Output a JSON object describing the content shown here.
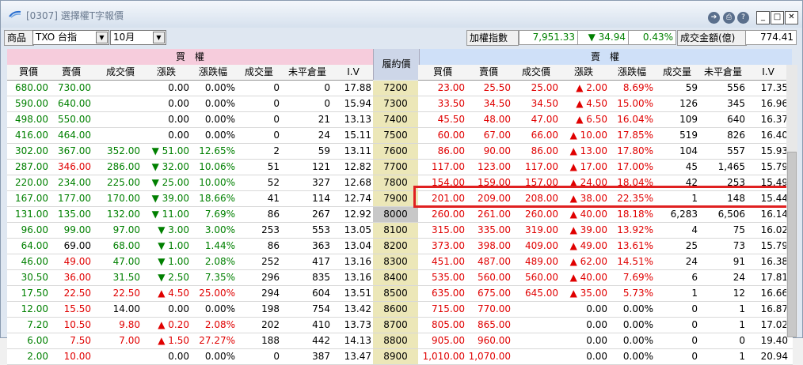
{
  "window": {
    "title": "[0307] 選擇權T字報價",
    "buttons": {
      "export": "➔",
      "print": "⎙",
      "help": "?",
      "minimize": "_",
      "maximize": "□",
      "close": "✕"
    }
  },
  "toolbar": {
    "product_label": "商品",
    "product_value": "TXO 台指",
    "month_value": "10月",
    "index_label": "加權指數",
    "index_value": "7,951.33",
    "index_change": "▼ 34.94",
    "index_pct": "0.43%",
    "turnover_label": "成交金額(億)",
    "turnover_value": "774.41"
  },
  "headers": {
    "buy_group": "買　權",
    "sell_group": "賣　權",
    "strike": "履約價",
    "call_cols": [
      "買價",
      "賣價",
      "成交價",
      "漲跌",
      "漲跌幅",
      "成交量",
      "未平倉量",
      "I.V"
    ],
    "put_cols": [
      "買價",
      "賣價",
      "成交價",
      "漲跌",
      "漲跌幅",
      "成交量",
      "未平倉量",
      "I.V"
    ]
  },
  "colors": {
    "up": "#e00000",
    "down": "#008000",
    "highlight": "#e02020"
  },
  "rows": [
    {
      "c": [
        "680.00",
        "730.00",
        "",
        "0.00",
        "0.00%",
        "0",
        "0",
        "17.88"
      ],
      "k": "7200",
      "p": [
        "23.00",
        "25.50",
        "25.00",
        "▲ 2.00",
        "8.69%",
        "59",
        "556",
        "17.35"
      ],
      "cc": [
        "down",
        "down",
        "neu",
        "neu",
        "neu",
        "neu",
        "neu",
        "neu"
      ],
      "pc": [
        "up",
        "up",
        "up",
        "up",
        "up",
        "neu",
        "neu",
        "neu"
      ]
    },
    {
      "c": [
        "590.00",
        "640.00",
        "",
        "0.00",
        "0.00%",
        "0",
        "0",
        "15.94"
      ],
      "k": "7300",
      "p": [
        "33.50",
        "34.50",
        "34.50",
        "▲ 4.50",
        "15.00%",
        "126",
        "345",
        "16.96"
      ],
      "cc": [
        "down",
        "down",
        "neu",
        "neu",
        "neu",
        "neu",
        "neu",
        "neu"
      ],
      "pc": [
        "up",
        "up",
        "up",
        "up",
        "up",
        "neu",
        "neu",
        "neu"
      ]
    },
    {
      "c": [
        "498.00",
        "550.00",
        "",
        "0.00",
        "0.00%",
        "0",
        "21",
        "13.13"
      ],
      "k": "7400",
      "p": [
        "45.50",
        "48.00",
        "47.00",
        "▲ 6.50",
        "16.04%",
        "109",
        "640",
        "16.37"
      ],
      "cc": [
        "down",
        "down",
        "neu",
        "neu",
        "neu",
        "neu",
        "neu",
        "neu"
      ],
      "pc": [
        "up",
        "up",
        "up",
        "up",
        "up",
        "neu",
        "neu",
        "neu"
      ]
    },
    {
      "c": [
        "416.00",
        "464.00",
        "",
        "0.00",
        "0.00%",
        "0",
        "24",
        "15.11"
      ],
      "k": "7500",
      "p": [
        "60.00",
        "67.00",
        "66.00",
        "▲ 10.00",
        "17.85%",
        "519",
        "826",
        "16.40"
      ],
      "cc": [
        "down",
        "down",
        "neu",
        "neu",
        "neu",
        "neu",
        "neu",
        "neu"
      ],
      "pc": [
        "up",
        "up",
        "up",
        "up",
        "up",
        "neu",
        "neu",
        "neu"
      ]
    },
    {
      "c": [
        "302.00",
        "367.00",
        "352.00",
        "▼ 51.00",
        "12.65%",
        "2",
        "59",
        "13.11"
      ],
      "k": "7600",
      "p": [
        "86.00",
        "90.00",
        "86.00",
        "▲ 13.00",
        "17.80%",
        "104",
        "557",
        "15.93"
      ],
      "cc": [
        "down",
        "down",
        "down",
        "down",
        "down",
        "neu",
        "neu",
        "neu"
      ],
      "pc": [
        "up",
        "up",
        "up",
        "up",
        "up",
        "neu",
        "neu",
        "neu"
      ]
    },
    {
      "c": [
        "287.00",
        "346.00",
        "286.00",
        "▼ 32.00",
        "10.06%",
        "51",
        "121",
        "12.82"
      ],
      "k": "7700",
      "p": [
        "117.00",
        "123.00",
        "117.00",
        "▲ 17.00",
        "17.00%",
        "45",
        "1,465",
        "15.79"
      ],
      "cc": [
        "down",
        "up",
        "down",
        "down",
        "down",
        "neu",
        "neu",
        "neu"
      ],
      "pc": [
        "up",
        "up",
        "up",
        "up",
        "up",
        "neu",
        "neu",
        "neu"
      ]
    },
    {
      "c": [
        "220.00",
        "234.00",
        "225.00",
        "▼ 25.00",
        "10.00%",
        "52",
        "327",
        "12.68"
      ],
      "k": "7800",
      "p": [
        "154.00",
        "159.00",
        "157.00",
        "▲ 24.00",
        "18.04%",
        "42",
        "253",
        "15.49"
      ],
      "cc": [
        "down",
        "down",
        "down",
        "down",
        "down",
        "neu",
        "neu",
        "neu"
      ],
      "pc": [
        "up",
        "up",
        "up",
        "up",
        "up",
        "neu",
        "neu",
        "neu"
      ]
    },
    {
      "c": [
        "167.00",
        "177.00",
        "170.00",
        "▼ 39.00",
        "18.66%",
        "41",
        "114",
        "12.74"
      ],
      "k": "7900",
      "p": [
        "201.00",
        "209.00",
        "208.00",
        "▲ 38.00",
        "22.35%",
        "1",
        "148",
        "15.44"
      ],
      "cc": [
        "down",
        "down",
        "down",
        "down",
        "down",
        "neu",
        "neu",
        "neu"
      ],
      "pc": [
        "up",
        "up",
        "up",
        "up",
        "up",
        "neu",
        "neu",
        "neu"
      ]
    },
    {
      "c": [
        "131.00",
        "135.00",
        "132.00",
        "▼ 11.00",
        "7.69%",
        "86",
        "267",
        "12.92"
      ],
      "k": "8000",
      "p": [
        "260.00",
        "261.00",
        "260.00",
        "▲ 40.00",
        "18.18%",
        "6,283",
        "6,506",
        "16.14"
      ],
      "cc": [
        "down",
        "down",
        "down",
        "down",
        "down",
        "neu",
        "neu",
        "neu"
      ],
      "pc": [
        "up",
        "up",
        "up",
        "up",
        "up",
        "neu",
        "neu",
        "neu"
      ],
      "atm": true
    },
    {
      "c": [
        "96.00",
        "99.00",
        "97.00",
        "▼ 3.00",
        "3.00%",
        "253",
        "553",
        "13.05"
      ],
      "k": "8100",
      "p": [
        "315.00",
        "335.00",
        "319.00",
        "▲ 39.00",
        "13.92%",
        "4",
        "75",
        "16.02"
      ],
      "cc": [
        "down",
        "down",
        "down",
        "down",
        "down",
        "neu",
        "neu",
        "neu"
      ],
      "pc": [
        "up",
        "up",
        "up",
        "up",
        "up",
        "neu",
        "neu",
        "neu"
      ]
    },
    {
      "c": [
        "64.00",
        "69.00",
        "68.00",
        "▼ 1.00",
        "1.44%",
        "86",
        "363",
        "13.04"
      ],
      "k": "8200",
      "p": [
        "373.00",
        "398.00",
        "409.00",
        "▲ 49.00",
        "13.61%",
        "25",
        "73",
        "15.79"
      ],
      "cc": [
        "down",
        "neu",
        "down",
        "down",
        "down",
        "neu",
        "neu",
        "neu"
      ],
      "pc": [
        "up",
        "up",
        "up",
        "up",
        "up",
        "neu",
        "neu",
        "neu"
      ]
    },
    {
      "c": [
        "46.00",
        "49.00",
        "47.00",
        "▼ 1.00",
        "2.08%",
        "252",
        "417",
        "13.16"
      ],
      "k": "8300",
      "p": [
        "451.00",
        "487.00",
        "489.00",
        "▲ 62.00",
        "14.51%",
        "24",
        "91",
        "16.38"
      ],
      "cc": [
        "down",
        "up",
        "down",
        "down",
        "down",
        "neu",
        "neu",
        "neu"
      ],
      "pc": [
        "up",
        "up",
        "up",
        "up",
        "up",
        "neu",
        "neu",
        "neu"
      ]
    },
    {
      "c": [
        "30.50",
        "36.00",
        "31.50",
        "▼ 2.50",
        "7.35%",
        "296",
        "835",
        "13.16"
      ],
      "k": "8400",
      "p": [
        "535.00",
        "560.00",
        "560.00",
        "▲ 40.00",
        "7.69%",
        "6",
        "24",
        "17.81"
      ],
      "cc": [
        "down",
        "up",
        "down",
        "down",
        "down",
        "neu",
        "neu",
        "neu"
      ],
      "pc": [
        "up",
        "up",
        "up",
        "up",
        "up",
        "neu",
        "neu",
        "neu"
      ]
    },
    {
      "c": [
        "17.50",
        "22.50",
        "22.50",
        "▲ 4.50",
        "25.00%",
        "294",
        "604",
        "13.51"
      ],
      "k": "8500",
      "p": [
        "635.00",
        "675.00",
        "645.00",
        "▲ 35.00",
        "5.73%",
        "1",
        "12",
        "16.66"
      ],
      "cc": [
        "down",
        "up",
        "up",
        "up",
        "up",
        "neu",
        "neu",
        "neu"
      ],
      "pc": [
        "up",
        "up",
        "up",
        "up",
        "up",
        "neu",
        "neu",
        "neu"
      ]
    },
    {
      "c": [
        "12.00",
        "15.50",
        "14.00",
        "0.00",
        "0.00%",
        "198",
        "754",
        "13.42"
      ],
      "k": "8600",
      "p": [
        "715.00",
        "770.00",
        "",
        "0.00",
        "0.00%",
        "0",
        "1",
        "16.87"
      ],
      "cc": [
        "down",
        "up",
        "neu",
        "neu",
        "neu",
        "neu",
        "neu",
        "neu"
      ],
      "pc": [
        "up",
        "up",
        "neu",
        "neu",
        "neu",
        "neu",
        "neu",
        "neu"
      ]
    },
    {
      "c": [
        "7.20",
        "10.50",
        "9.80",
        "▲ 0.20",
        "2.08%",
        "202",
        "410",
        "13.73"
      ],
      "k": "8700",
      "p": [
        "805.00",
        "865.00",
        "",
        "0.00",
        "0.00%",
        "0",
        "1",
        "17.02"
      ],
      "cc": [
        "down",
        "up",
        "up",
        "up",
        "up",
        "neu",
        "neu",
        "neu"
      ],
      "pc": [
        "up",
        "up",
        "neu",
        "neu",
        "neu",
        "neu",
        "neu",
        "neu"
      ]
    },
    {
      "c": [
        "6.00",
        "7.50",
        "7.00",
        "▲ 1.50",
        "27.27%",
        "188",
        "442",
        "14.13"
      ],
      "k": "8800",
      "p": [
        "905.00",
        "960.00",
        "",
        "0.00",
        "0.00%",
        "0",
        "0",
        "19.40"
      ],
      "cc": [
        "down",
        "up",
        "up",
        "up",
        "up",
        "neu",
        "neu",
        "neu"
      ],
      "pc": [
        "up",
        "up",
        "neu",
        "neu",
        "neu",
        "neu",
        "neu",
        "neu"
      ]
    },
    {
      "c": [
        "2.00",
        "10.00",
        "",
        "0.00",
        "0.00%",
        "0",
        "387",
        "13.47"
      ],
      "k": "8900",
      "p": [
        "1,010.00",
        "1,070.00",
        "",
        "0.00",
        "0.00%",
        "0",
        "1",
        "20.94"
      ],
      "cc": [
        "down",
        "up",
        "neu",
        "neu",
        "neu",
        "neu",
        "neu",
        "neu"
      ],
      "pc": [
        "up",
        "up",
        "neu",
        "neu",
        "neu",
        "neu",
        "neu",
        "neu"
      ]
    }
  ]
}
